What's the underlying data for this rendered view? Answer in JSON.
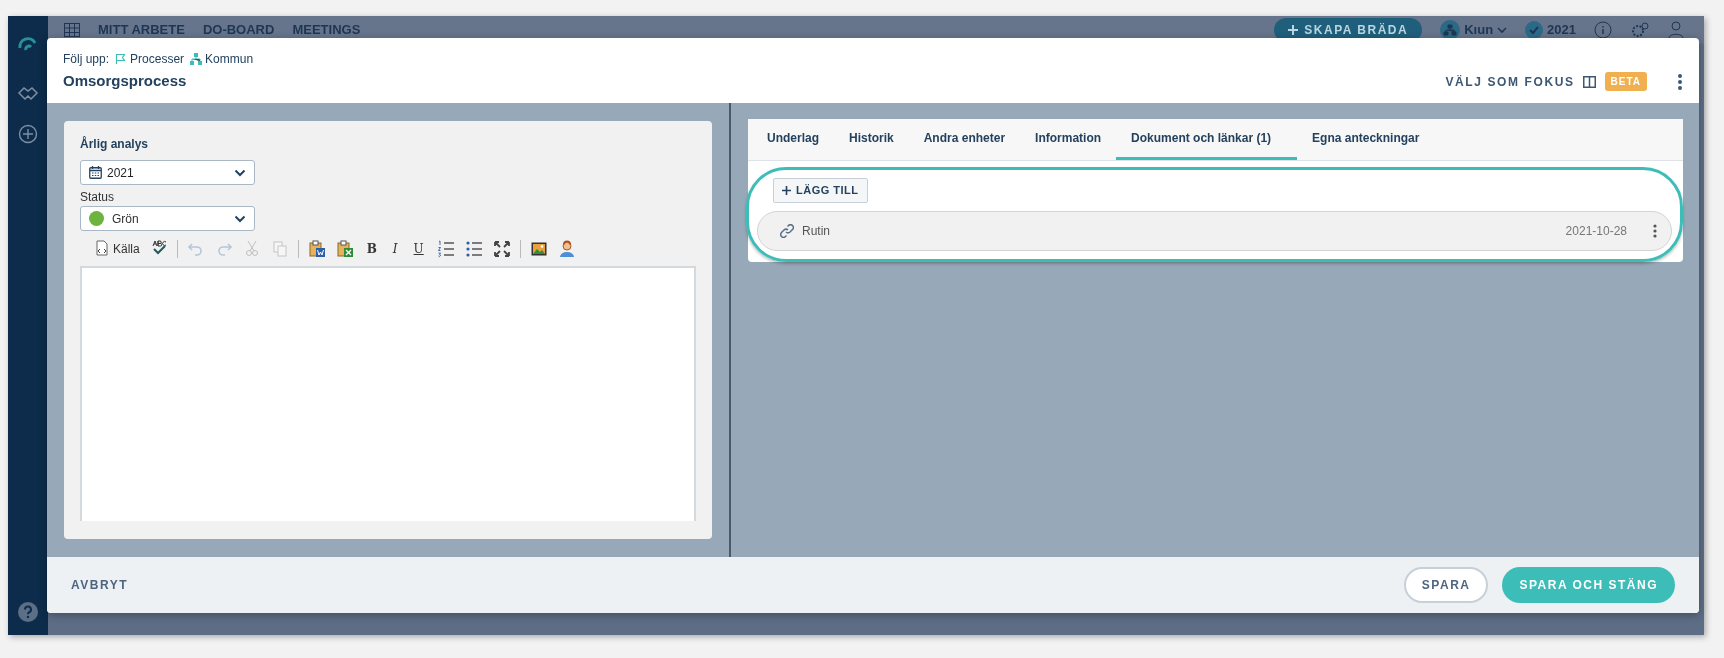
{
  "app_nav": {
    "items": [
      "MITT ARBETE",
      "DO-BOARD",
      "MEETINGS"
    ],
    "create_button": "SKAPA BRÄDA",
    "unit": "Kıun",
    "year": "2021"
  },
  "modal": {
    "breadcrumb": {
      "label": "Följ upp:",
      "links": [
        "Processer",
        "Kommun"
      ]
    },
    "title": "Omsorgsprocess",
    "focus_label": "VÄLJ SOM FOKUS",
    "badge": "BETA"
  },
  "left_panel": {
    "section_title": "Årlig analys",
    "year_select": "2021",
    "status_label": "Status",
    "status_select": {
      "value": "Grön",
      "color": "#6cb33f"
    },
    "toolbar": [
      {
        "kind": "source",
        "label": "Källa",
        "disabled": false
      },
      {
        "kind": "spellcheck",
        "disabled": false
      },
      {
        "kind": "separator"
      },
      {
        "kind": "undo",
        "disabled": true
      },
      {
        "kind": "redo",
        "disabled": true
      },
      {
        "kind": "cut",
        "disabled": true
      },
      {
        "kind": "copy",
        "disabled": true
      },
      {
        "kind": "separator"
      },
      {
        "kind": "paste-word",
        "disabled": false
      },
      {
        "kind": "paste-excel",
        "disabled": false
      },
      {
        "kind": "bold",
        "label": "B",
        "disabled": false
      },
      {
        "kind": "italic",
        "label": "I",
        "disabled": false
      },
      {
        "kind": "underline",
        "label": "U",
        "disabled": false
      },
      {
        "kind": "numbered-list",
        "disabled": false
      },
      {
        "kind": "bullet-list",
        "disabled": false
      },
      {
        "kind": "maximize",
        "disabled": false
      },
      {
        "kind": "separator"
      },
      {
        "kind": "image",
        "disabled": false
      },
      {
        "kind": "person",
        "disabled": false
      }
    ]
  },
  "tabs": [
    {
      "label": "Underlag",
      "selected": false
    },
    {
      "label": "Historik",
      "selected": false
    },
    {
      "label": "Andra enheter",
      "selected": false
    },
    {
      "label": "Information",
      "selected": false
    },
    {
      "label": "Dokument och länkar (1)",
      "selected": true
    },
    {
      "label": "Egna anteckningar",
      "selected": false
    }
  ],
  "documents": {
    "add_button": "LÄGG TILL",
    "items": [
      {
        "name": "Rutin",
        "date": "2021-10-28"
      }
    ]
  },
  "footer": {
    "cancel": "AVBRYT",
    "save": "SPARA",
    "save_close": "SPARA OCH STÄNG"
  }
}
